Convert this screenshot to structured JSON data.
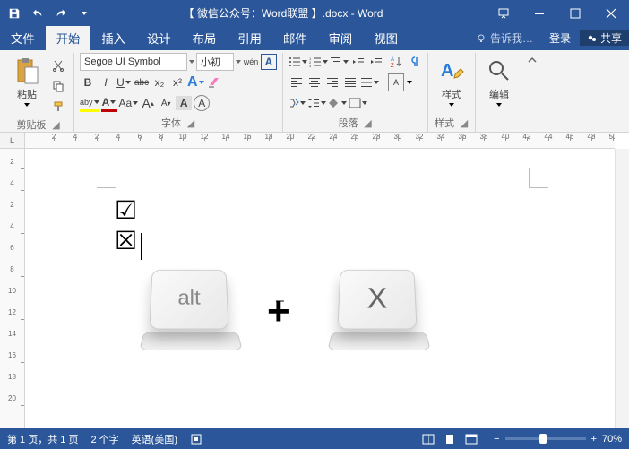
{
  "title": "【 微信公众号：Word联盟 】.docx - Word",
  "tabs": [
    "文件",
    "开始",
    "插入",
    "设计",
    "布局",
    "引用",
    "邮件",
    "审阅",
    "视图"
  ],
  "active_tab_index": 1,
  "tellme": "告诉我…",
  "signin": "登录",
  "share": "共享",
  "ribbon": {
    "clipboard": {
      "label": "剪贴板",
      "paste": "粘贴"
    },
    "font": {
      "label": "字体",
      "name": "Segoe UI Symbol",
      "size": "小初",
      "bold": "B",
      "italic": "I",
      "underline": "U",
      "strike": "abc",
      "sub": "x₂",
      "sup": "x²",
      "aa": "Aa",
      "grow": "A",
      "shrink": "A",
      "clear": "A",
      "wen": "wén",
      "boxA": "A",
      "aby": "aby",
      "fontcolorA": "A",
      "highlightA": "A",
      "charborderA": "A"
    },
    "paragraph": {
      "label": "段落"
    },
    "styles": {
      "label": "样式",
      "btn": "样式"
    },
    "editing": {
      "label": "",
      "btn": "编辑"
    }
  },
  "ruler": {
    "corner": "L",
    "h": [
      "2",
      "4",
      "2",
      "4",
      "6",
      "8",
      "10",
      "12",
      "14",
      "16",
      "18",
      "20",
      "22",
      "24",
      "26",
      "28",
      "30",
      "32",
      "34",
      "36",
      "38",
      "40",
      "42",
      "44",
      "46",
      "48",
      "50"
    ],
    "v": [
      "2",
      "4",
      "2",
      "4",
      "6",
      "8",
      "10",
      "12",
      "14",
      "16",
      "18",
      "20"
    ]
  },
  "document": {
    "chars": [
      "☑",
      "☒"
    ],
    "key1": "alt",
    "plus": "+",
    "key2": "X"
  },
  "status": {
    "page": "第 1 页，共 1 页",
    "words": "2 个字",
    "lang": "英语(美国)",
    "zoom_minus": "−",
    "zoom_plus": "+",
    "zoom": "70%"
  }
}
